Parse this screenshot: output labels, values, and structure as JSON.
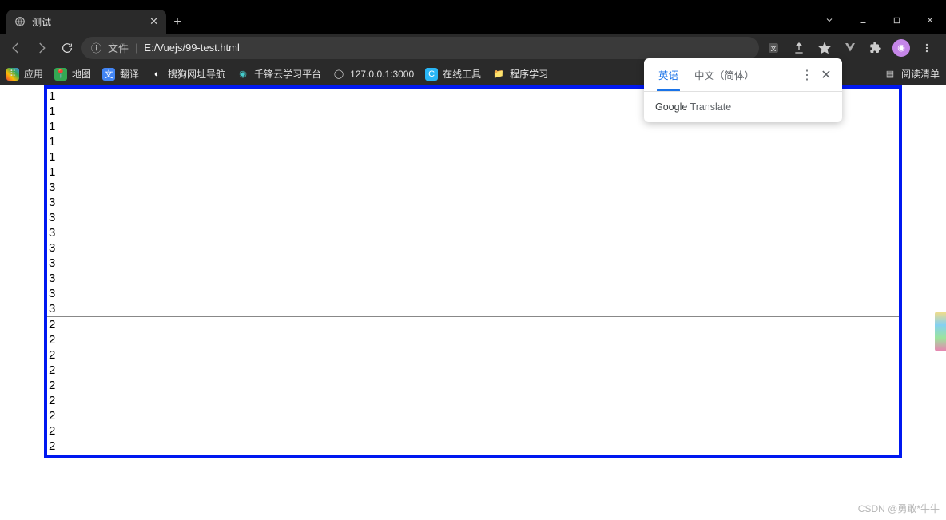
{
  "tab": {
    "title": "测试"
  },
  "nav": {
    "file_label": "文件",
    "url": "E:/Vuejs/99-test.html"
  },
  "bookmarks": {
    "items": [
      {
        "label": "应用"
      },
      {
        "label": "地图"
      },
      {
        "label": "翻译"
      },
      {
        "label": "搜狗网址导航"
      },
      {
        "label": "千锋云学习平台"
      },
      {
        "label": "127.0.0.1:3000"
      },
      {
        "label": "在线工具"
      },
      {
        "label": "程序学习"
      }
    ],
    "reading_list": "阅读清单"
  },
  "translate": {
    "tab_en": "英语",
    "tab_zh": "中文（简体）",
    "brand_strong": "Google",
    "brand_rest": " Translate"
  },
  "content": {
    "upper_lines": [
      "1",
      "1",
      "1",
      "1",
      "1",
      "1",
      "3",
      "3",
      "3",
      "3",
      "3",
      "3",
      "3",
      "3",
      "3"
    ],
    "lower_lines": [
      "2",
      "2",
      "2",
      "2",
      "2",
      "2",
      "2",
      "2",
      "2"
    ]
  },
  "watermark": "CSDN @勇敢*牛牛"
}
